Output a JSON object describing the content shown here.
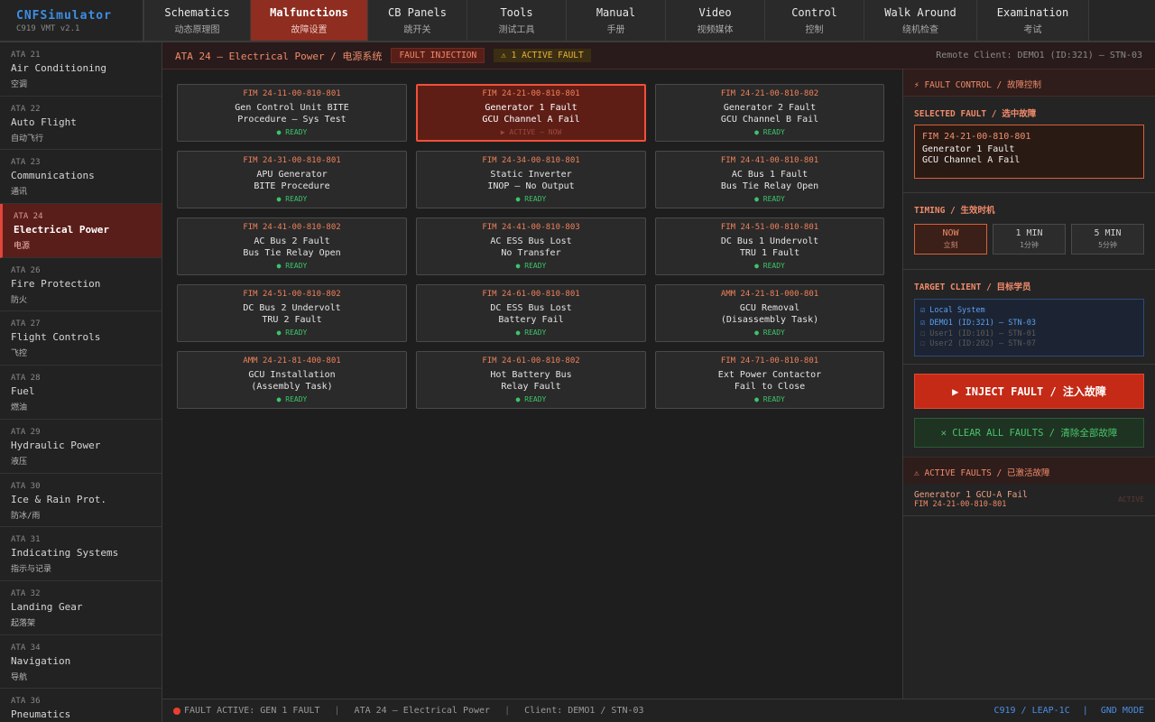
{
  "brand": {
    "name": "CNFSimulator",
    "version": "C919 VMT v2.1"
  },
  "nav_tabs": [
    {
      "en": "Schematics",
      "zh": "动态原理图",
      "active": false
    },
    {
      "en": "Malfunctions",
      "zh": "故障设置",
      "active": true
    },
    {
      "en": "CB Panels",
      "zh": "跳开关",
      "active": false
    },
    {
      "en": "Tools",
      "zh": "测试工具",
      "active": false
    },
    {
      "en": "Manual",
      "zh": "手册",
      "active": false
    },
    {
      "en": "Video",
      "zh": "视频媒体",
      "active": false
    },
    {
      "en": "Control",
      "zh": "控制",
      "active": false
    },
    {
      "en": "Walk Around",
      "zh": "绕机检查",
      "active": false
    },
    {
      "en": "Examination",
      "zh": "考试",
      "active": false
    }
  ],
  "sidebar": {
    "items": [
      {
        "code": "ATA 21",
        "title": "Air Conditioning",
        "zh": "空调"
      },
      {
        "code": "ATA 22",
        "title": "Auto Flight",
        "zh": "自动飞行"
      },
      {
        "code": "ATA 23",
        "title": "Communications",
        "zh": "通讯"
      },
      {
        "code": "ATA 24",
        "title": "Electrical Power",
        "zh": "电源",
        "active": true
      },
      {
        "code": "ATA 26",
        "title": "Fire Protection",
        "zh": "防火"
      },
      {
        "code": "ATA 27",
        "title": "Flight Controls",
        "zh": "飞控"
      },
      {
        "code": "ATA 28",
        "title": "Fuel",
        "zh": "燃油"
      },
      {
        "code": "ATA 29",
        "title": "Hydraulic Power",
        "zh": "液压"
      },
      {
        "code": "ATA 30",
        "title": "Ice & Rain Prot.",
        "zh": "防冰/雨"
      },
      {
        "code": "ATA 31",
        "title": "Indicating Systems",
        "zh": "指示与记录"
      },
      {
        "code": "ATA 32",
        "title": "Landing Gear",
        "zh": "起落架"
      },
      {
        "code": "ATA 34",
        "title": "Navigation",
        "zh": "导航"
      },
      {
        "code": "ATA 36",
        "title": "Pneumatics",
        "zh": ""
      }
    ]
  },
  "header": {
    "breadcrumb": "ATA 24 — Electrical Power / 电源系统",
    "fault_injection_badge": "FAULT INJECTION",
    "active_fault_badge": "⚠ 1 ACTIVE FAULT",
    "remote_client": "Remote Client: DEMO1 (ID:321) — STN-03"
  },
  "faults": [
    {
      "code": "FIM 24-11-00-810-801",
      "line1": "Gen Control Unit BITE",
      "line2": "Procedure – Sys Test",
      "status": "● READY"
    },
    {
      "code": "FIM 24-21-00-810-801",
      "line1": "Generator 1 Fault",
      "line2": "GCU Channel A Fail",
      "status": "▶ ACTIVE — NOW",
      "selected": true
    },
    {
      "code": "FIM 24-21-00-810-802",
      "line1": "Generator 2 Fault",
      "line2": "GCU Channel B Fail",
      "status": "● READY"
    },
    {
      "code": "FIM 24-31-00-810-801",
      "line1": "APU Generator",
      "line2": "BITE Procedure",
      "status": "● READY"
    },
    {
      "code": "FIM 24-34-00-810-801",
      "line1": "Static Inverter",
      "line2": "INOP — No Output",
      "status": "● READY"
    },
    {
      "code": "FIM 24-41-00-810-801",
      "line1": "AC Bus 1 Fault",
      "line2": "Bus Tie Relay Open",
      "status": "● READY"
    },
    {
      "code": "FIM 24-41-00-810-802",
      "line1": "AC Bus 2 Fault",
      "line2": "Bus Tie Relay Open",
      "status": "● READY"
    },
    {
      "code": "FIM 24-41-00-810-803",
      "line1": "AC ESS Bus Lost",
      "line2": "No Transfer",
      "status": "● READY"
    },
    {
      "code": "FIM 24-51-00-810-801",
      "line1": "DC Bus 1 Undervolt",
      "line2": "TRU 1 Fault",
      "status": "● READY"
    },
    {
      "code": "FIM 24-51-00-810-802",
      "line1": "DC Bus 2 Undervolt",
      "line2": "TRU 2 Fault",
      "status": "● READY"
    },
    {
      "code": "FIM 24-61-00-810-801",
      "line1": "DC ESS Bus Lost",
      "line2": "Battery Fail",
      "status": "● READY"
    },
    {
      "code": "AMM 24-21-81-000-801",
      "line1": "GCU Removal",
      "line2": "(Disassembly Task)",
      "status": "● READY"
    },
    {
      "code": "AMM 24-21-81-400-801",
      "line1": "GCU Installation",
      "line2": "(Assembly Task)",
      "status": "● READY"
    },
    {
      "code": "FIM 24-61-00-810-802",
      "line1": "Hot Battery Bus",
      "line2": "Relay Fault",
      "status": "● READY"
    },
    {
      "code": "FIM 24-71-00-810-801",
      "line1": "Ext Power Contactor",
      "line2": "Fail to Close",
      "status": "● READY"
    }
  ],
  "right_panel": {
    "header": "⚡ FAULT CONTROL / 故障控制",
    "selected_label": "SELECTED FAULT / 选中故障",
    "selected_code": "FIM 24-21-00-810-801",
    "selected_line1": "Generator 1 Fault",
    "selected_line2": "GCU Channel A Fail",
    "timing_label": "TIMING / 生效时机",
    "timing": [
      {
        "label": "NOW",
        "sub": "立刻",
        "active": true
      },
      {
        "label": "1 MIN",
        "sub": "1分钟"
      },
      {
        "label": "5 MIN",
        "sub": "5分钟"
      }
    ],
    "target_label": "TARGET CLIENT / 目标学员",
    "clients": [
      {
        "label": "☑ Local System",
        "checked": true
      },
      {
        "label": "☑ DEMO1 (ID:321) — STN-03",
        "checked": true
      },
      {
        "label": "☐ User1 (ID:101) — STN-01",
        "checked": false
      },
      {
        "label": "☐ User2 (ID:202) — STN-07",
        "checked": false
      }
    ],
    "inject_label": "▶ INJECT FAULT / 注入故障",
    "clear_label": "✕ CLEAR ALL FAULTS / 清除全部故障",
    "active_header": "⚠ ACTIVE FAULTS / 已激活故障",
    "active_faults": [
      {
        "name": "Generator 1 GCU-A Fail",
        "code": "FIM 24-21-00-810-801",
        "state": "ACTIVE"
      }
    ]
  },
  "footer": {
    "status": "FAULT ACTIVE: GEN 1 FAULT",
    "ata": "ATA 24 — Electrical Power",
    "client": "Client: DEMO1 / STN-03",
    "aircraft": "C919 / LEAP-1C",
    "mode": "GND MODE"
  }
}
